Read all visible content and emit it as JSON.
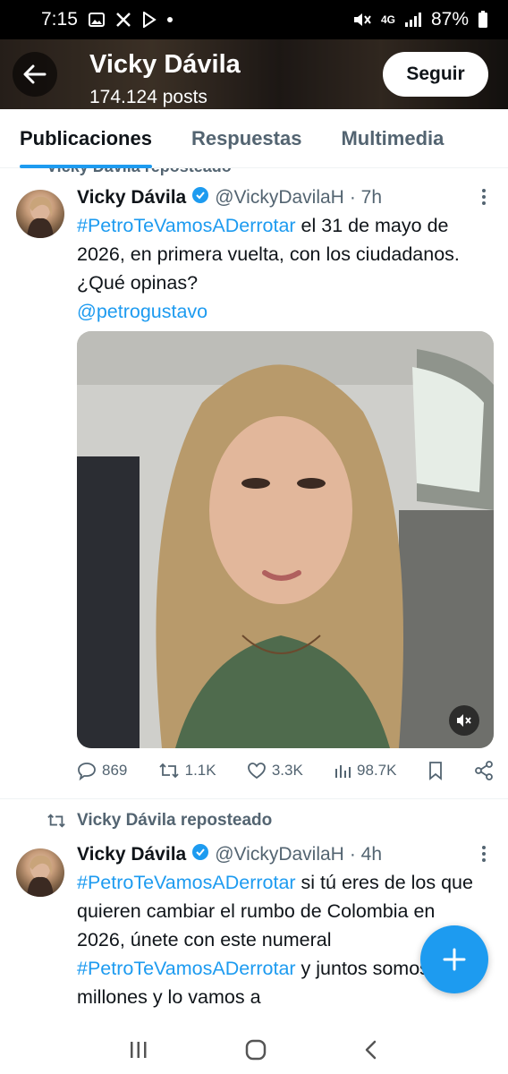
{
  "status_bar": {
    "time": "7:15",
    "network": "4G",
    "battery": "87%",
    "icons": [
      "gallery-icon",
      "x-icon",
      "play-store-icon",
      "notification-dot-icon",
      "mute-icon",
      "signal-icon",
      "battery-icon"
    ]
  },
  "header": {
    "title": "Vicky Dávila",
    "posts_count": "174.124 posts",
    "follow_label": "Seguir"
  },
  "tabs": [
    {
      "label": "Publicaciones",
      "active": true
    },
    {
      "label": "Respuestas",
      "active": false
    },
    {
      "label": "Multimedia",
      "active": false
    }
  ],
  "feed": {
    "cut_repost_label": "Vicky Dávila reposteado",
    "tweets": [
      {
        "name": "Vicky Dávila",
        "handle": "@VickyDavilaH",
        "time": "· 7h",
        "hashtag": "#PetroTeVamosADerrotar",
        "text_after_hashtag": " el 31 de mayo de 2026, en primera vuelta, con los ciudadanos. ¿Qué opinas?",
        "mention": "@petrogustavo",
        "stats": {
          "replies": "869",
          "reposts": "1.1K",
          "likes": "3.3K",
          "views": "98.7K"
        }
      },
      {
        "repost_label": "Vicky Dávila reposteado",
        "name": "Vicky Dávila",
        "handle": "@VickyDavilaH",
        "time": "· 4h",
        "hashtag": "#PetroTeVamosADerrotar",
        "text_part1": " si tú eres de los que quieren cambiar el rumbo de Colombia en 2026, únete con este numeral ",
        "hashtag2": "#PetroTeVamosADerrotar",
        "text_part2": " y juntos somos millones y lo vamos a"
      }
    ]
  },
  "colors": {
    "accent": "#1d9bf0",
    "text": "#0f1419",
    "muted": "#536471"
  }
}
